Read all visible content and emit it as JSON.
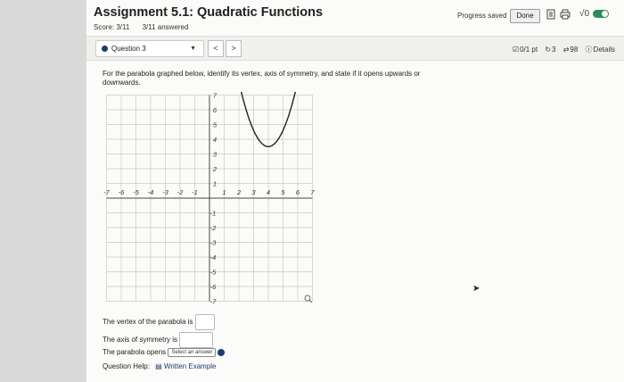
{
  "header": {
    "title": "Assignment 5.1: Quadratic Functions",
    "score": "Score: 3/11",
    "answered": "3/11 answered",
    "progress_status": "Progress saved",
    "done_label": "Done",
    "sqrt_symbol": "√0"
  },
  "question_bar": {
    "question_label": "Question 3",
    "prev": "<",
    "next": ">",
    "points": "0/1 pt",
    "retries": "3",
    "attempts": "98",
    "details": "Details"
  },
  "question": {
    "instruction": "For the parabola graphed below, identify its vertex, axis of symmetry, and state if it opens upwards or downwards.",
    "x_ticks": [
      "-7",
      "-6",
      "-5",
      "-4",
      "-3",
      "-2",
      "-1",
      "1",
      "2",
      "3",
      "4",
      "5",
      "6",
      "7"
    ],
    "y_ticks_pos": [
      "7",
      "6",
      "5",
      "4",
      "3",
      "2",
      "1"
    ],
    "y_ticks_neg": [
      "-1",
      "-2",
      "-3",
      "-4",
      "-5",
      "-6",
      "-7"
    ],
    "parabola": {
      "vertex_x": 4,
      "vertex_y": 3.5,
      "a": 1.1
    }
  },
  "answers": {
    "vertex_label": "The vertex of the parabola is",
    "axis_label": "The axis of symmetry is",
    "opens_label": "The parabola opens",
    "select_placeholder": "Select an answer"
  },
  "help": {
    "label": "Question Help:",
    "link": "Written Example"
  }
}
